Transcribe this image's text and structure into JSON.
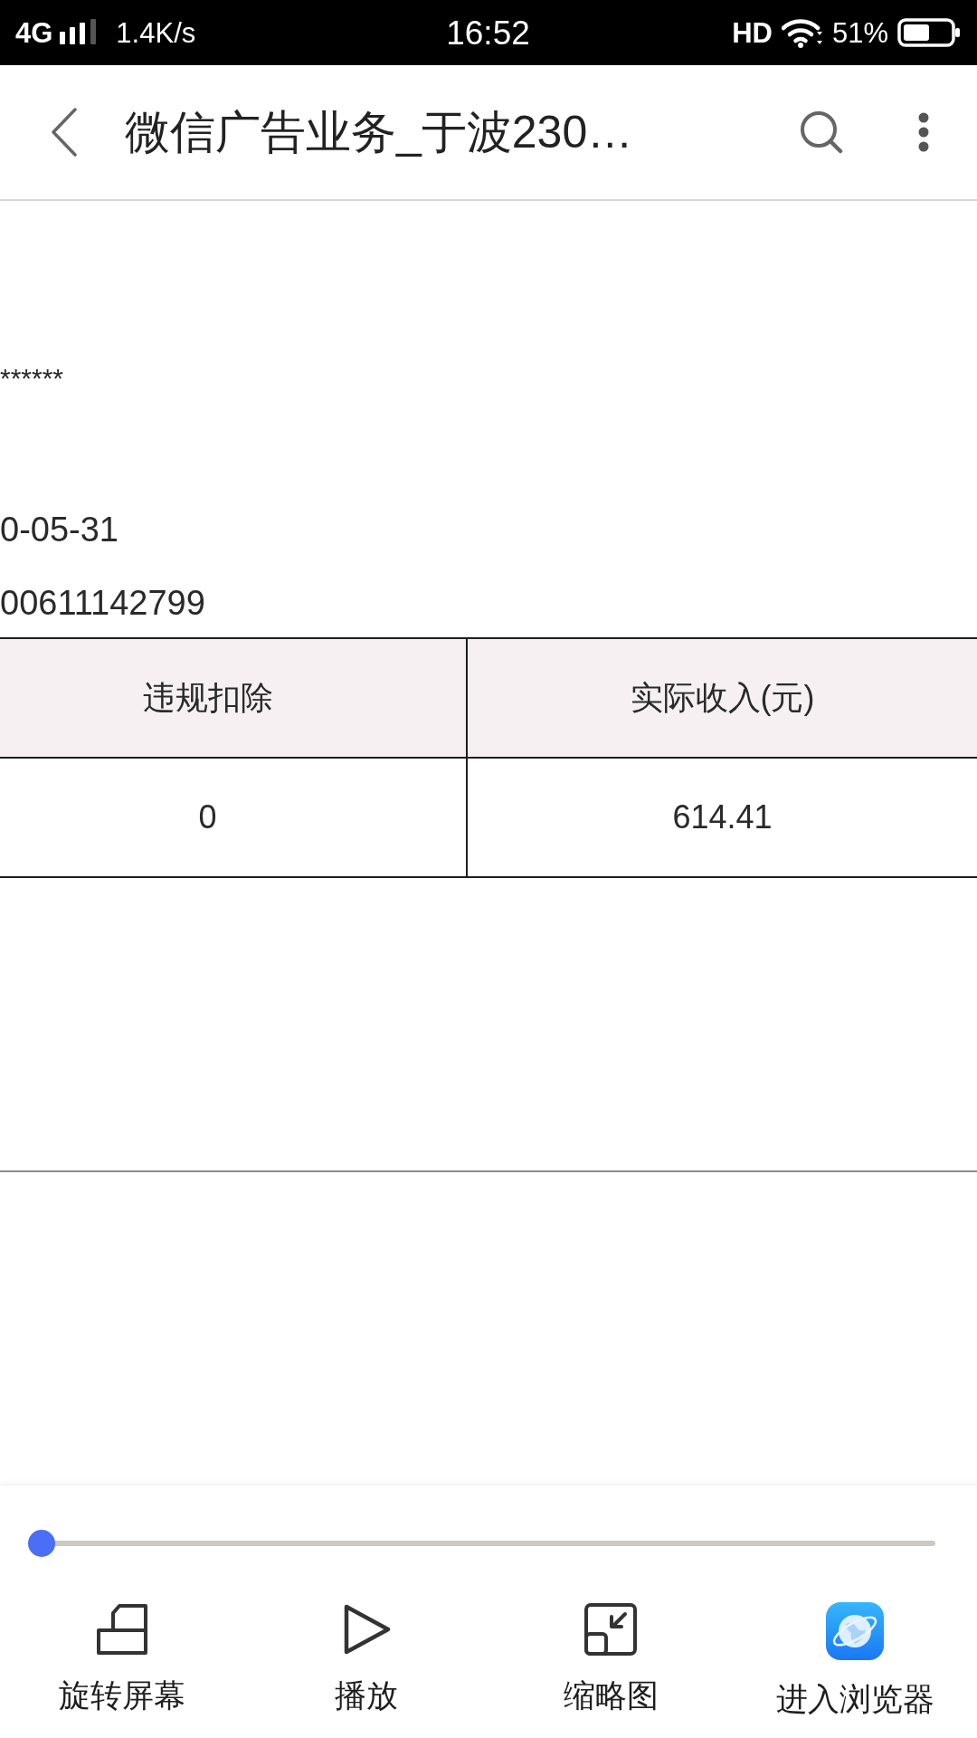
{
  "status_bar": {
    "network": "4G",
    "speed": "1.4K/s",
    "time": "16:52",
    "hd": "HD",
    "battery": "51%"
  },
  "toolbar": {
    "title": "微信广告业务_于波230…"
  },
  "document": {
    "masked_value": "******",
    "date": "0-05-31",
    "number": "00611142799",
    "table": {
      "columns": [
        "违规扣除",
        "实际收入(元)"
      ],
      "rows": [
        [
          "0",
          "614.41"
        ]
      ]
    }
  },
  "bottom_bar": {
    "slider": {
      "level": 0
    },
    "actions": [
      {
        "kind": "rotate",
        "label": "旋转屏幕"
      },
      {
        "kind": "play",
        "label": "播放"
      },
      {
        "kind": "thumbnail",
        "label": "缩略图"
      },
      {
        "kind": "browser",
        "label": "进入浏览器"
      }
    ]
  }
}
